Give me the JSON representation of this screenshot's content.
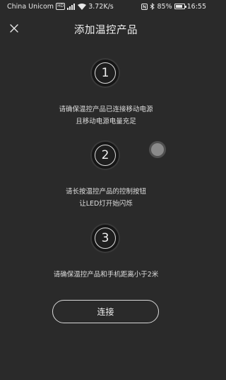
{
  "status_bar": {
    "carrier": "China Unicom",
    "hd": "HD",
    "network_speed": "3.72K/s",
    "battery_percent": "85%",
    "battery_level": 0.85,
    "time": "16:55"
  },
  "header": {
    "title": "添加温控产品"
  },
  "steps": [
    {
      "number": "1",
      "line1": "请确保温控产品已连接移动电源",
      "line2": "且移动电源电量充足"
    },
    {
      "number": "2",
      "line1": "请长按温控产品的控制按钮",
      "line2": "让LED灯开始闪烁"
    },
    {
      "number": "3",
      "line1": "请确保温控产品和手机距离小于2米",
      "line2": ""
    }
  ],
  "connect_button": {
    "label": "连接"
  },
  "colors": {
    "background": "#2a2a2a",
    "text": "#e6e6e6"
  }
}
